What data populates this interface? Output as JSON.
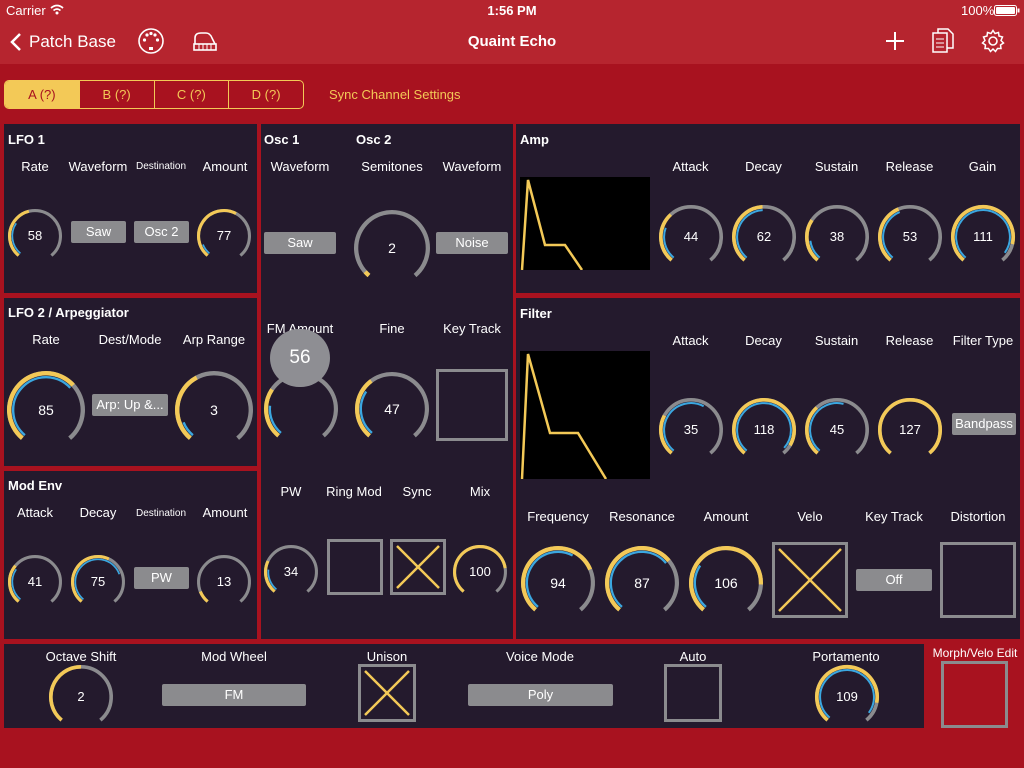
{
  "status": {
    "carrier": "Carrier",
    "time": "1:56 PM",
    "battery": "100%"
  },
  "nav": {
    "back_label": "Patch Base",
    "title": "Quaint Echo"
  },
  "colors": {
    "accent": "#f3c957",
    "accent_blue": "#3ba7e0",
    "panel": "#241a2d",
    "background": "#a8121f",
    "track": "#8b8b8e"
  },
  "tabs": [
    "A (?)",
    "B (?)",
    "C (?)",
    "D (?)"
  ],
  "sync_label": "Sync Channel Settings",
  "lfo1": {
    "title": "LFO 1",
    "labels": {
      "rate": "Rate",
      "waveform": "Waveform",
      "destination": "Destination",
      "amount": "Amount"
    },
    "rate": "58",
    "waveform": "Saw",
    "destination": "Osc 2",
    "amount": "77"
  },
  "lfo2": {
    "title": "LFO 2 / Arpeggiator",
    "labels": {
      "rate": "Rate",
      "dest_mode": "Dest/Mode",
      "arp_range": "Arp Range"
    },
    "rate": "85",
    "dest_mode": "Arp: Up &...",
    "arp_range": "3"
  },
  "modenv": {
    "title": "Mod Env",
    "labels": {
      "attack": "Attack",
      "decay": "Decay",
      "destination": "Destination",
      "amount": "Amount"
    },
    "attack": "41",
    "decay": "75",
    "destination": "PW",
    "amount": "13"
  },
  "osc": {
    "osc1_title": "Osc 1",
    "osc2_title": "Osc 2",
    "labels": {
      "waveform1": "Waveform",
      "semitones": "Semitones",
      "waveform2": "Waveform",
      "fm_amount": "FM Amount",
      "fine": "Fine",
      "key_track": "Key Track",
      "pw": "PW",
      "ring_mod": "Ring Mod",
      "sync": "Sync",
      "mix": "Mix"
    },
    "waveform1": "Saw",
    "semitones": "2",
    "waveform2": "Noise",
    "fm_amount": "56",
    "fine": "47",
    "pw": "34",
    "mix": "100"
  },
  "amp": {
    "title": "Amp",
    "labels": {
      "attack": "Attack",
      "decay": "Decay",
      "sustain": "Sustain",
      "release": "Release",
      "gain": "Gain"
    },
    "attack": "44",
    "decay": "62",
    "sustain": "38",
    "release": "53",
    "gain": "111"
  },
  "filter": {
    "title": "Filter",
    "labels": {
      "attack": "Attack",
      "decay": "Decay",
      "sustain": "Sustain",
      "release": "Release",
      "filter_type": "Filter Type",
      "frequency": "Frequency",
      "resonance": "Resonance",
      "amount": "Amount",
      "velo": "Velo",
      "key_track": "Key Track",
      "distortion": "Distortion"
    },
    "attack": "35",
    "decay": "118",
    "sustain": "45",
    "release": "127",
    "filter_type": "Bandpass",
    "frequency": "94",
    "resonance": "87",
    "amount": "106",
    "key_track": "Off"
  },
  "global": {
    "labels": {
      "octave_shift": "Octave Shift",
      "mod_wheel": "Mod Wheel",
      "unison": "Unison",
      "voice_mode": "Voice Mode",
      "auto": "Auto",
      "portamento": "Portamento"
    },
    "octave_shift": "2",
    "mod_wheel": "FM",
    "voice_mode": "Poly",
    "portamento": "109"
  },
  "morph_label": "Morph/Velo Edit",
  "knob_levels": {
    "lfo1-rate": {
      "yellow": 0.45,
      "blue": 0.3
    },
    "lfo1-amount": {
      "yellow": 0.6,
      "blue": 0.1
    },
    "lfo2-rate": {
      "yellow": 0.67,
      "blue": 0.67
    },
    "lfo2-arp-range": {
      "yellow": 0.4,
      "blue": 0.1
    },
    "modenv-attack": {
      "yellow": 0.32,
      "blue": 0.3
    },
    "modenv-decay": {
      "yellow": 0.59,
      "blue": 0.75
    },
    "modenv-amount": {
      "yellow": 0.1,
      "blue": 0
    },
    "osc-semitones": {
      "yellow": 0.03,
      "blue": 0
    },
    "osc-fm-amount": {
      "yellow": 0.3,
      "blue": 0.2
    },
    "osc-fine": {
      "yellow": 0.37,
      "blue": 0.3
    },
    "osc-pw": {
      "yellow": 0.27,
      "blue": 0.2
    },
    "osc-mix": {
      "yellow": 0.79,
      "blue": 0
    },
    "amp-attack": {
      "yellow": 0.35,
      "blue": 0.25
    },
    "amp-decay": {
      "yellow": 0.49,
      "blue": 0.49
    },
    "amp-sustain": {
      "yellow": 0.3,
      "blue": 0.15
    },
    "amp-release": {
      "yellow": 0.42,
      "blue": 0.42
    },
    "amp-gain": {
      "yellow": 0.87,
      "blue": 0.95
    },
    "filter-attack": {
      "yellow": 0.28,
      "blue": 0.6
    },
    "filter-decay": {
      "yellow": 0.93,
      "blue": 0.97
    },
    "filter-sustain": {
      "yellow": 0.35,
      "blue": 0.55
    },
    "filter-release": {
      "yellow": 1.0,
      "blue": 0
    },
    "filter-frequency": {
      "yellow": 0.74,
      "blue": 0.6
    },
    "filter-resonance": {
      "yellow": 0.68,
      "blue": 0.68
    },
    "filter-amount": {
      "yellow": 0.83,
      "blue": 0.3
    },
    "global-octave-shift": {
      "yellow": 0.5,
      "blue": 0
    },
    "global-portamento": {
      "yellow": 0.86,
      "blue": 0.95
    }
  }
}
